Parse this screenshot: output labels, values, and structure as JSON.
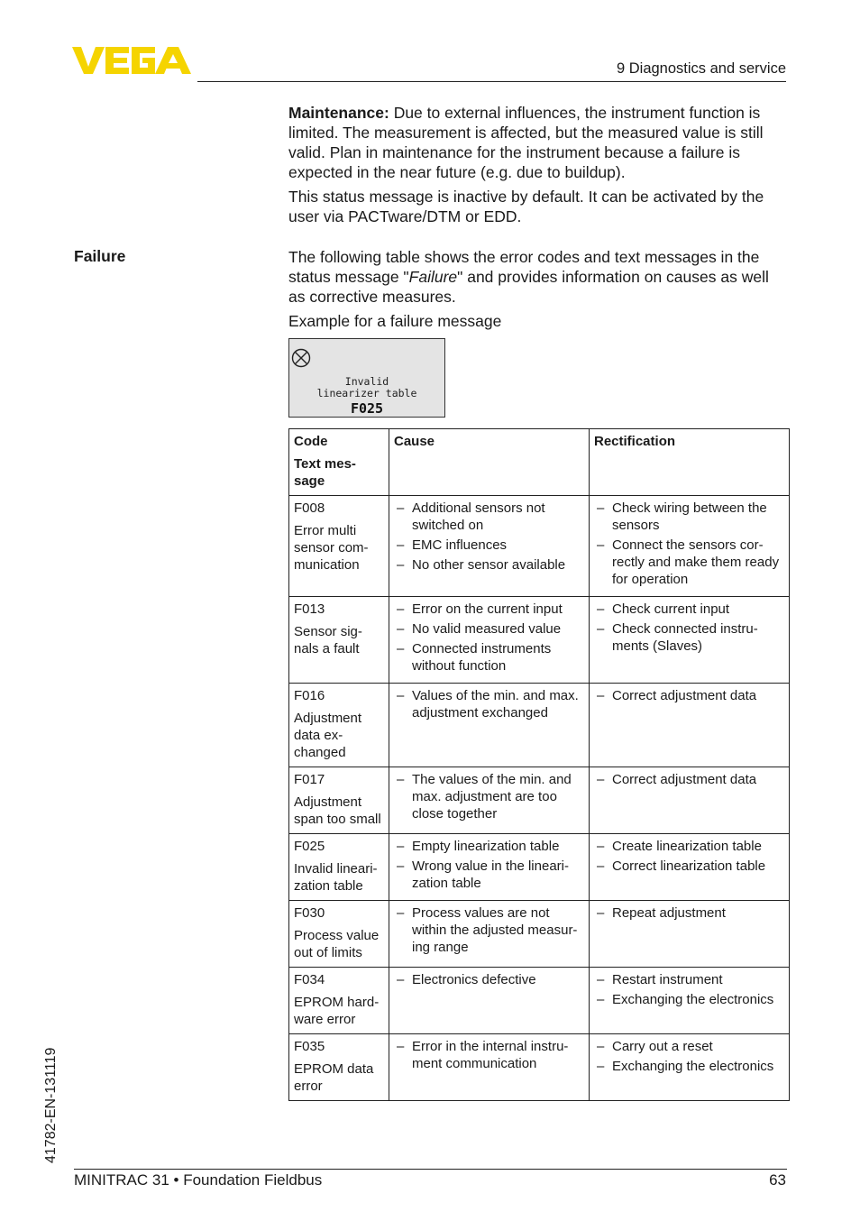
{
  "header": {
    "logo_text": "VEGA",
    "brand_color": "#f5d400",
    "section_title": "9 Diagnostics and service"
  },
  "intro": {
    "maintenance_label": "Maintenance:",
    "maintenance_text": " Due to external influences, the instrument function is limited. The measurement is affected, but the measured value is still valid. Plan in maintenance for the instrument  because a failure is expected in the near future (e.g. due to buildup).",
    "inactive_note": "This status message is inactive by default. It can be activated by the user via PACTware/DTM or EDD."
  },
  "failure": {
    "side_label": "Failure",
    "desc_before": "The following table shows the error codes and text messages in the status message \"",
    "desc_italic": "Failure",
    "desc_after": "\" and provides information on causes as well as corrective measures.",
    "example_caption": "Example for a failure message",
    "display": {
      "icon": "failure-x-circle-icon",
      "message_line1": "Invalid",
      "message_line2": "linearizer table",
      "code": "F025"
    }
  },
  "table": {
    "headers": {
      "code": "Code",
      "text_message": "Text mes-sage",
      "cause": "Cause",
      "rectification": "Rectification"
    },
    "rows": [
      {
        "code": "F008",
        "text": "Error multi sensor com-munication",
        "causes": [
          "Additional sensors not switched on",
          "EMC influences",
          "No other sensor available"
        ],
        "rectifications": [
          "Check wiring between the sensors",
          "Connect the sensors cor-rectly and make them ready for operation"
        ]
      },
      {
        "code": "F013",
        "text": "Sensor sig-nals a fault",
        "causes": [
          "Error on the current input",
          "No valid measured value",
          "Connected instruments without function"
        ],
        "rectifications": [
          "Check current input",
          "Check connected instru-ments (Slaves)"
        ]
      },
      {
        "code": "F016",
        "text": "Adjustment data ex-changed",
        "causes": [
          "Values of the min. and max. adjustment exchanged"
        ],
        "rectifications": [
          "Correct adjustment data"
        ]
      },
      {
        "code": "F017",
        "text": "Adjustment span too small",
        "causes": [
          "The values of the min. and max. adjustment are too close together"
        ],
        "rectifications": [
          "Correct adjustment data"
        ]
      },
      {
        "code": "F025",
        "text": "Invalid lineari-zation table",
        "causes": [
          "Empty linearization table",
          "Wrong value in the lineari-zation table"
        ],
        "rectifications": [
          "Create linearization table",
          "Correct linearization table"
        ]
      },
      {
        "code": "F030",
        "text": "Process value out of limits",
        "causes": [
          "Process values are not within the adjusted measur-ing range"
        ],
        "rectifications": [
          "Repeat adjustment"
        ]
      },
      {
        "code": "F034",
        "text": "EPROM hard-ware error",
        "causes": [
          "Electronics defective"
        ],
        "rectifications": [
          "Restart instrument",
          "Exchanging the electronics"
        ]
      },
      {
        "code": "F035",
        "text": "EPROM data error",
        "causes": [
          "Error in the internal instru-ment communication"
        ],
        "rectifications": [
          "Carry out a reset",
          "Exchanging the electronics"
        ]
      }
    ]
  },
  "footer": {
    "doc_id": "41782-EN-131119",
    "product": "MINITRAC 31 • Foundation Fieldbus",
    "page_number": "63"
  }
}
